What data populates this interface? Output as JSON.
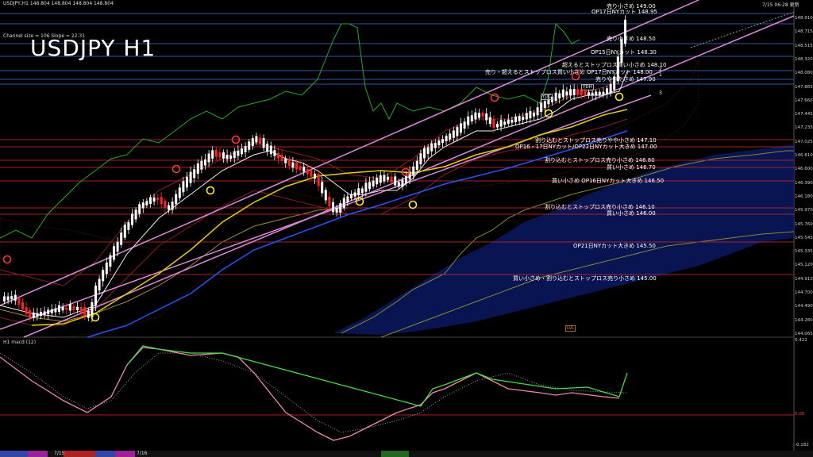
{
  "header": {
    "symbol_info": "USDJPY,H1  148.804 148.804 148.804 148.804",
    "big_title": "USDJPY H1",
    "channel_info": "Channel size = 106 Slope = 22.31",
    "clock": "7/15 06:28 更新"
  },
  "macd": {
    "label": "H1  macd (12)",
    "axis_labels": [
      "0.422",
      "0.00",
      "-0.182"
    ]
  },
  "price_axis": [
    "148.910",
    "148.715",
    "148.515",
    "148.320",
    "148.080",
    "147.865",
    "147.660",
    "147.445",
    "147.235",
    "147.025",
    "146.810",
    "146.600",
    "146.390",
    "146.180",
    "145.970",
    "145.760",
    "145.545",
    "145.335",
    "145.120",
    "144.910",
    "144.700",
    "144.490",
    "144.280",
    "144.065"
  ],
  "levels": [
    {
      "text": "売り小さめ 149.00"
    },
    {
      "text": "OP17日NYカット 148.95"
    },
    {
      "text": "売り小さめ 148.50"
    },
    {
      "text": "OP15日NYカット 148.30"
    },
    {
      "text": "超えるとストップロス買い小さめ 148.10"
    },
    {
      "text": "売り・超えるとストップロス買い小さめ  OP17日NYカット 148.00"
    },
    {
      "text": "売りややたさめ 147.90"
    },
    {
      "text": "割り込むとストップロス売りやや小さめ 147.10"
    },
    {
      "text": "OP16・17日NYカット/OP22日NYカット大きめ 147.00"
    },
    {
      "text": "割り込むとストップロス売り小さめ 146.80"
    },
    {
      "text": "買い小さめ 146.70"
    },
    {
      "text": "買い小さめ  OP16日NYカット大きめ 146.50"
    },
    {
      "text": "割り込むとストップロス売り小さめ 146.10"
    },
    {
      "text": "買い小さめ 146.00"
    },
    {
      "text": "OP21日NYカット大きめ 145.50"
    },
    {
      "text": "買い小さめ・割り込むとストップロス売り小さめ 145.00"
    }
  ],
  "markers": {
    "ydc": "YDC",
    "ydh": "YDH",
    "lvh": "LVH",
    "lvl": "LVL",
    "chan_nums": [
      "2",
      "1",
      "3"
    ]
  },
  "taskbar": {
    "date1": "7/15",
    "date2": "7/16",
    "date3": "7/15",
    "date4": "7/16"
  },
  "colors": {
    "background": "#000000",
    "bull": "#ffffff",
    "bear": "#ff2222",
    "channel": "#dd88dd",
    "ichimoku_blue": "#1f3fbf",
    "ma_yellow": "#e0d000",
    "macd_line": "#44dd44",
    "macd_signal": "#ee88aa"
  }
}
